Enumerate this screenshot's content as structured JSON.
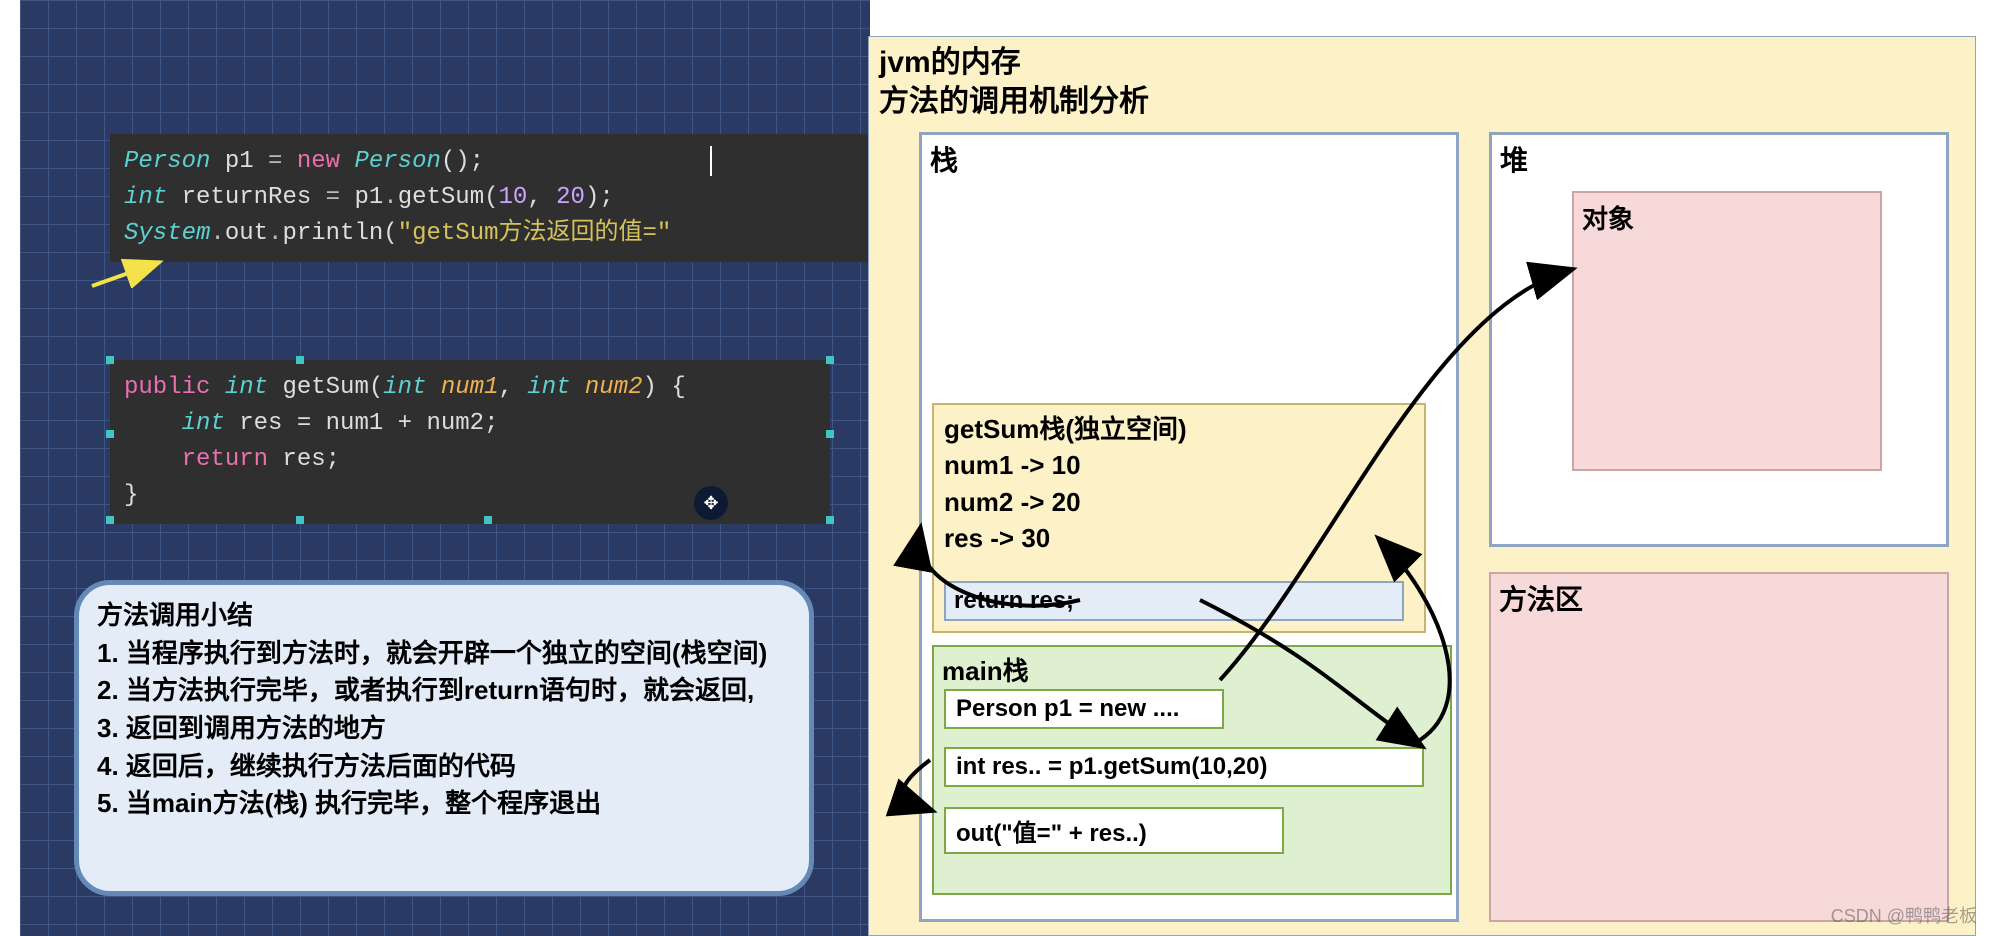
{
  "jvm_panel": {
    "title": "jvm的内存\n方法的调用机制分析",
    "stack_label": "栈",
    "heap_label": "堆",
    "object_label": "对象",
    "method_area_label": "方法区"
  },
  "getsum_frame": {
    "title": "getSum栈(独立空间)",
    "line1": "num1 -> 10",
    "line2": "num2 -> 20",
    "line3": "res -> 30",
    "return_stmt": "return res;"
  },
  "main_frame": {
    "title": "main栈",
    "stmt1": "Person p1 = new ....",
    "stmt2": "int res.. = p1.getSum(10,20)",
    "stmt3": "out(\"值=\" + res..)"
  },
  "code1": {
    "l1a": "Person",
    "l1b": " p1 ",
    "l1c": "=",
    "l1d": " new ",
    "l1e": "Person",
    "l1f": "();",
    "l2a": "int",
    "l2b": " returnRes ",
    "l2c": "=",
    "l2d": " p1",
    "l2e": ".",
    "l2f": "getSum",
    "l2g": "(",
    "l2h": "10",
    "l2i": ", ",
    "l2j": "20",
    "l2k": ");",
    "l3a": "System",
    "l3b": ".",
    "l3c": "out",
    "l3d": ".",
    "l3e": "println",
    "l3f": "(",
    "l3g": "\"getSum方法返回的值=\""
  },
  "code2": {
    "l1a": "public ",
    "l1b": "int ",
    "l1c": "getSum",
    "l1d": "(",
    "l1e": "int ",
    "l1f": "num1",
    "l1g": ", ",
    "l1h": "int ",
    "l1i": "num2",
    "l1j": ") {",
    "l2a": "    int",
    "l2b": " res = num1 + num2;",
    "l3a": "    return",
    "l3b": " res;",
    "l4": "}"
  },
  "summary": {
    "title": "方法调用小结",
    "i1": "1. 当程序执行到方法时，就会开辟一个独立的空间(栈空间)",
    "i2": "2. 当方法执行完毕，或者执行到return语句时，就会返回,",
    "i3": "3. 返回到调用方法的地方",
    "i4": "4. 返回后，继续执行方法后面的代码",
    "i5": "5. 当main方法(栈) 执行完毕，整个程序退出"
  },
  "watermark": "CSDN @鸭鸭老板"
}
